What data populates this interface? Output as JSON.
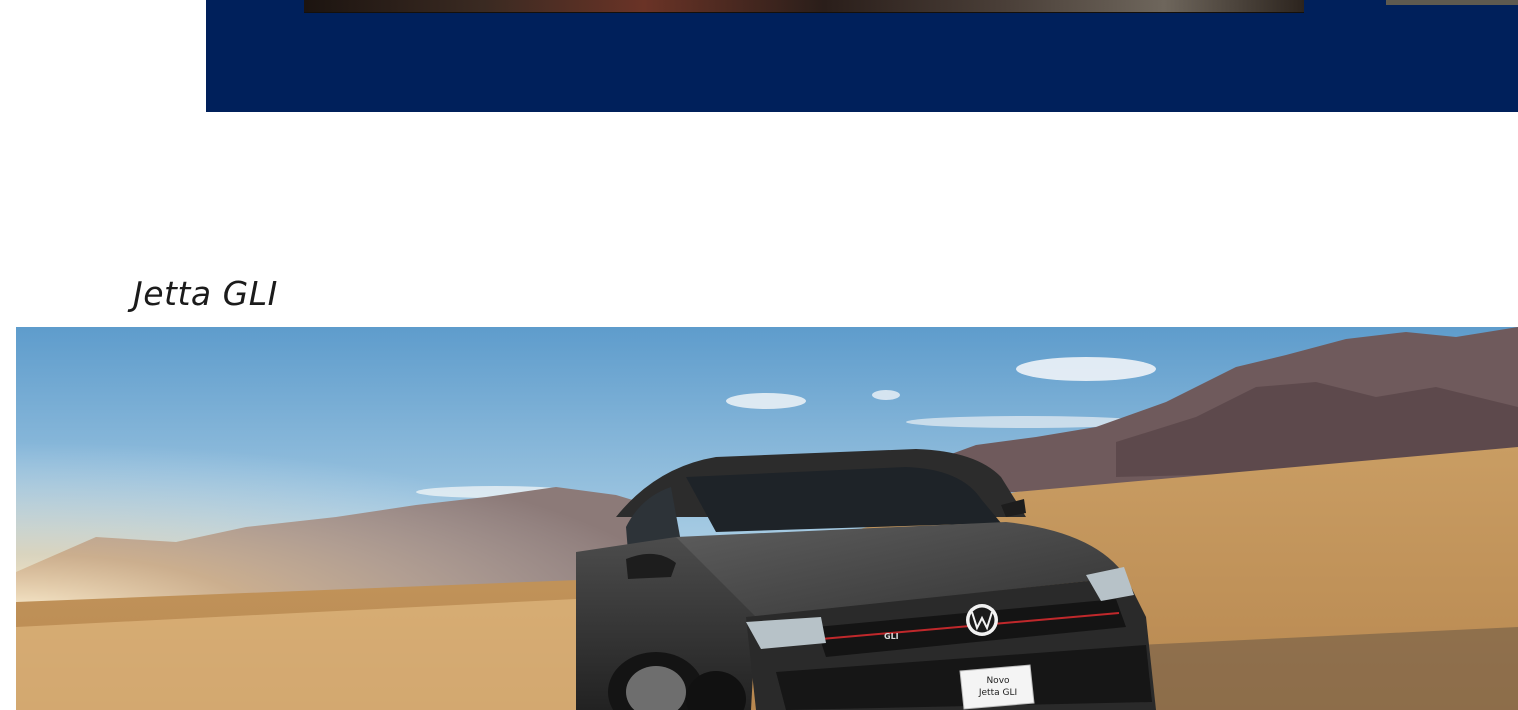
{
  "hero": {
    "band_color": "#00205b"
  },
  "section": {
    "title": "Jetta GLI"
  },
  "car_image": {
    "alt": "Novo Jetta GLI",
    "plate_line1": "Novo",
    "plate_line2": "Jetta GLI",
    "grille_badge": "GLI",
    "icon": "vw-logo-icon"
  }
}
